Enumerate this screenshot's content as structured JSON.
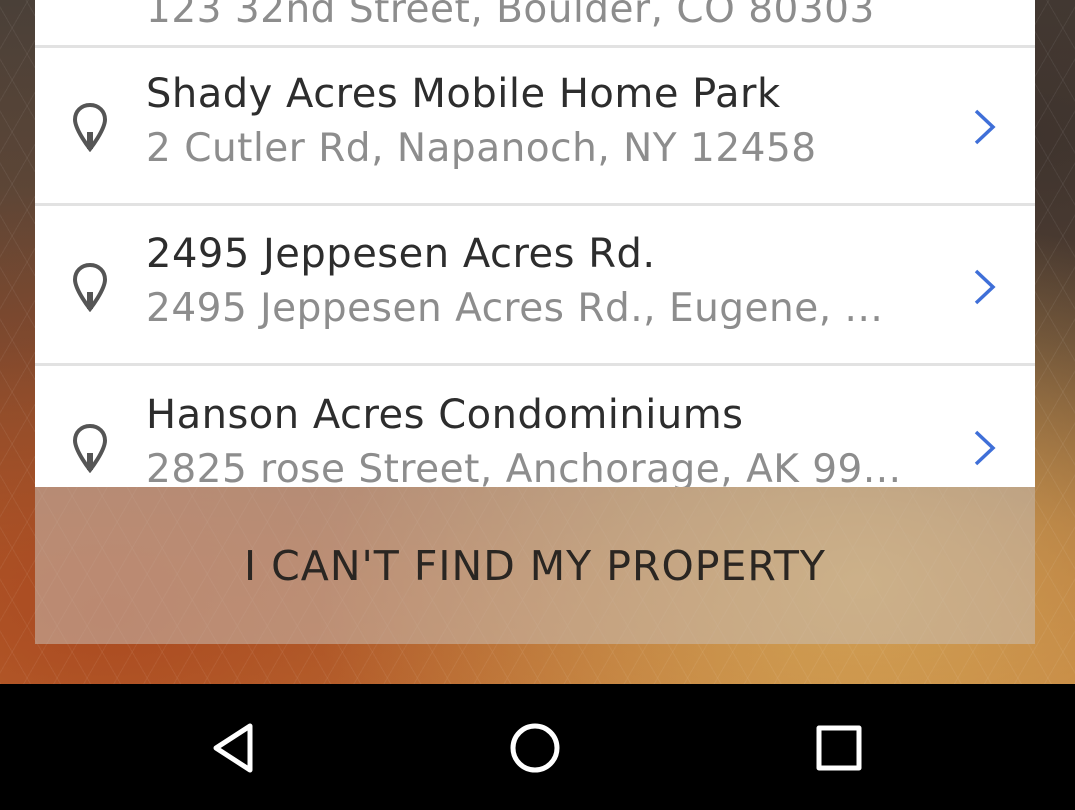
{
  "results": [
    {
      "title": "",
      "address": "123 32nd Street, Boulder, CO 80303",
      "partial": true
    },
    {
      "title": "Shady Acres Mobile Home Park",
      "address": "2 Cutler Rd, Napanoch, NY 12458"
    },
    {
      "title": "2495 Jeppesen Acres Rd.",
      "address": "2495 Jeppesen Acres Rd., Eugene, ..."
    },
    {
      "title": "Hanson Acres Condominiums",
      "address": "2825 rose Street, Anchorage, AK 99..."
    }
  ],
  "cant_find_label": "I CAN'T FIND MY PROPERTY",
  "colors": {
    "chevron": "#3f6fd8",
    "pin": "#555555",
    "title_text": "#2d2d2d",
    "address_text": "#8d8d8d"
  },
  "icons": {
    "pin": "map-pin-icon",
    "chevron": "chevron-right-icon",
    "nav_back": "back-triangle-icon",
    "nav_home": "home-circle-icon",
    "nav_recent": "recent-apps-square-icon"
  }
}
